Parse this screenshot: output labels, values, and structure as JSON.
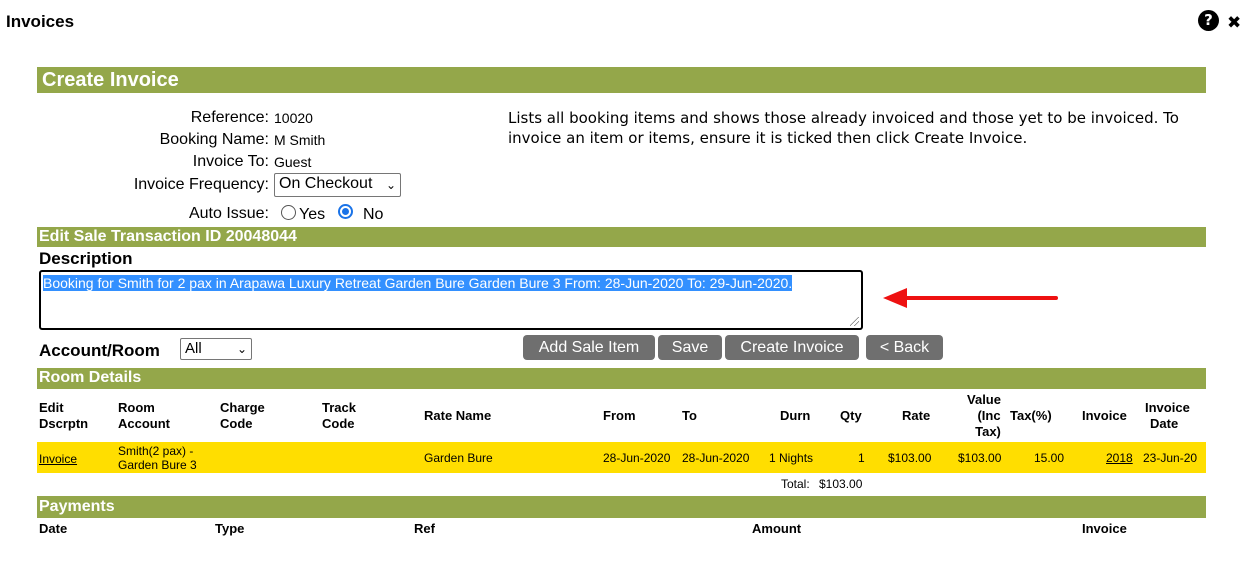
{
  "window": {
    "title": "Invoices"
  },
  "header_icons": {
    "help": "?",
    "close": "✖"
  },
  "create_invoice": {
    "heading": "Create Invoice",
    "fields": {
      "reference_label": "Reference:",
      "reference_value": "10020",
      "booking_name_label": "Booking Name:",
      "booking_name_value": "M Smith",
      "invoice_to_label": "Invoice To:",
      "invoice_to_value": "Guest",
      "frequency_label": "Invoice Frequency:",
      "frequency_value": "On Checkout",
      "auto_issue_label": "Auto Issue:",
      "auto_issue_yes": "Yes",
      "auto_issue_no": "No"
    },
    "info_text": "Lists all booking items and shows those already invoiced and those yet to be invoiced. To invoice an item or items, ensure it is ticked then click Create Invoice."
  },
  "edit_sale": {
    "heading": "Edit Sale Transaction ID 20048044",
    "description_label": "Description",
    "description_value": "Booking for Smith for 2 pax in Arapawa Luxury Retreat Garden Bure Garden Bure 3 From: 28-Jun-2020 To: 29-Jun-2020.",
    "account_room_label": "Account/Room",
    "account_room_value": "All"
  },
  "buttons": {
    "add_sale_item": "Add Sale Item",
    "save": "Save",
    "create_invoice": "Create Invoice",
    "back": "< Back"
  },
  "room_details": {
    "heading": "Room Details",
    "columns": {
      "edit": [
        "Edit",
        "Dscrptn"
      ],
      "room_account": [
        "Room",
        "Account"
      ],
      "charge_code": [
        "Charge",
        "Code"
      ],
      "track_code": [
        "Track",
        "Code"
      ],
      "rate_name": "Rate Name",
      "from": "From",
      "to": "To",
      "durn": "Durn",
      "qty": "Qty",
      "rate": "Rate",
      "value": [
        "Value",
        "(Inc",
        "Tax)"
      ],
      "tax": "Tax(%)",
      "invoice": "Invoice",
      "invoice_date": [
        "Invoice",
        "Date"
      ]
    },
    "rows": [
      {
        "edit_link": "Invoice",
        "room_account_1": "Smith(2 pax) -",
        "room_account_2": "Garden Bure 3",
        "rate_name": "Garden Bure",
        "from": "28-Jun-2020",
        "to": "28-Jun-2020",
        "durn": "1 Nights",
        "qty": "1",
        "rate": "$103.00",
        "value": "$103.00",
        "tax": "15.00",
        "invoice": "2018",
        "invoice_date": "23-Jun-20"
      }
    ],
    "total_label": "Total:",
    "total_value": "$103.00"
  },
  "payments": {
    "heading": "Payments",
    "columns": {
      "date": "Date",
      "type": "Type",
      "ref": "Ref",
      "amount": "Amount",
      "invoice": "Invoice"
    }
  },
  "colors": {
    "section_bar": "#94a74a",
    "highlight_row": "#ffde00",
    "button": "#6f6f6f",
    "arrow": "#ee1111",
    "selection": "#3390ff"
  }
}
